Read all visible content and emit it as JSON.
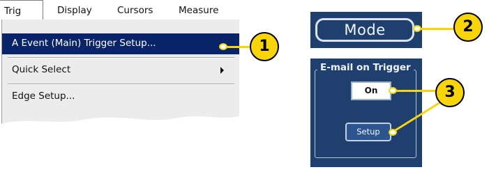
{
  "menubar": {
    "items": [
      "Trig",
      "Display",
      "Cursors",
      "Measure"
    ]
  },
  "dropdown": {
    "items": [
      {
        "label": "A Event (Main) Trigger Setup..."
      },
      {
        "label": "Quick Select"
      },
      {
        "label": "Edge Setup..."
      }
    ]
  },
  "mode_panel": {
    "button_label": "Mode"
  },
  "email_panel": {
    "title": "E-mail on Trigger",
    "on_label": "On",
    "setup_label": "Setup"
  },
  "callouts": [
    "1",
    "2",
    "3"
  ],
  "colors": {
    "highlight": "#0a246a",
    "panel_bg": "#1f3f6e",
    "callout": "#f8d40b",
    "menu_bg": "#ececec"
  }
}
